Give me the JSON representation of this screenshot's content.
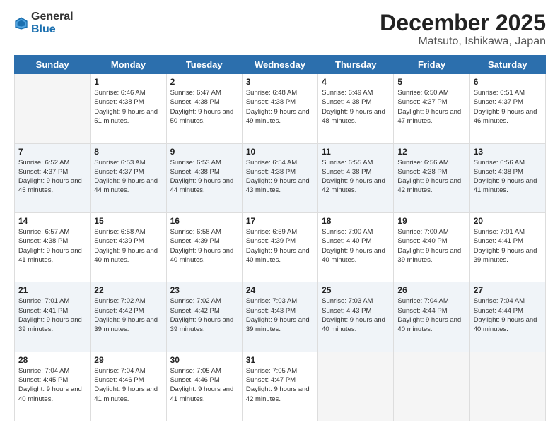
{
  "header": {
    "logo_general": "General",
    "logo_blue": "Blue",
    "month_title": "December 2025",
    "location": "Matsuto, Ishikawa, Japan"
  },
  "days_of_week": [
    "Sunday",
    "Monday",
    "Tuesday",
    "Wednesday",
    "Thursday",
    "Friday",
    "Saturday"
  ],
  "weeks": [
    [
      {
        "day": "",
        "sunrise": "",
        "sunset": "",
        "daylight": ""
      },
      {
        "day": "1",
        "sunrise": "Sunrise: 6:46 AM",
        "sunset": "Sunset: 4:38 PM",
        "daylight": "Daylight: 9 hours and 51 minutes."
      },
      {
        "day": "2",
        "sunrise": "Sunrise: 6:47 AM",
        "sunset": "Sunset: 4:38 PM",
        "daylight": "Daylight: 9 hours and 50 minutes."
      },
      {
        "day": "3",
        "sunrise": "Sunrise: 6:48 AM",
        "sunset": "Sunset: 4:38 PM",
        "daylight": "Daylight: 9 hours and 49 minutes."
      },
      {
        "day": "4",
        "sunrise": "Sunrise: 6:49 AM",
        "sunset": "Sunset: 4:38 PM",
        "daylight": "Daylight: 9 hours and 48 minutes."
      },
      {
        "day": "5",
        "sunrise": "Sunrise: 6:50 AM",
        "sunset": "Sunset: 4:37 PM",
        "daylight": "Daylight: 9 hours and 47 minutes."
      },
      {
        "day": "6",
        "sunrise": "Sunrise: 6:51 AM",
        "sunset": "Sunset: 4:37 PM",
        "daylight": "Daylight: 9 hours and 46 minutes."
      }
    ],
    [
      {
        "day": "7",
        "sunrise": "Sunrise: 6:52 AM",
        "sunset": "Sunset: 4:37 PM",
        "daylight": "Daylight: 9 hours and 45 minutes."
      },
      {
        "day": "8",
        "sunrise": "Sunrise: 6:53 AM",
        "sunset": "Sunset: 4:37 PM",
        "daylight": "Daylight: 9 hours and 44 minutes."
      },
      {
        "day": "9",
        "sunrise": "Sunrise: 6:53 AM",
        "sunset": "Sunset: 4:38 PM",
        "daylight": "Daylight: 9 hours and 44 minutes."
      },
      {
        "day": "10",
        "sunrise": "Sunrise: 6:54 AM",
        "sunset": "Sunset: 4:38 PM",
        "daylight": "Daylight: 9 hours and 43 minutes."
      },
      {
        "day": "11",
        "sunrise": "Sunrise: 6:55 AM",
        "sunset": "Sunset: 4:38 PM",
        "daylight": "Daylight: 9 hours and 42 minutes."
      },
      {
        "day": "12",
        "sunrise": "Sunrise: 6:56 AM",
        "sunset": "Sunset: 4:38 PM",
        "daylight": "Daylight: 9 hours and 42 minutes."
      },
      {
        "day": "13",
        "sunrise": "Sunrise: 6:56 AM",
        "sunset": "Sunset: 4:38 PM",
        "daylight": "Daylight: 9 hours and 41 minutes."
      }
    ],
    [
      {
        "day": "14",
        "sunrise": "Sunrise: 6:57 AM",
        "sunset": "Sunset: 4:38 PM",
        "daylight": "Daylight: 9 hours and 41 minutes."
      },
      {
        "day": "15",
        "sunrise": "Sunrise: 6:58 AM",
        "sunset": "Sunset: 4:39 PM",
        "daylight": "Daylight: 9 hours and 40 minutes."
      },
      {
        "day": "16",
        "sunrise": "Sunrise: 6:58 AM",
        "sunset": "Sunset: 4:39 PM",
        "daylight": "Daylight: 9 hours and 40 minutes."
      },
      {
        "day": "17",
        "sunrise": "Sunrise: 6:59 AM",
        "sunset": "Sunset: 4:39 PM",
        "daylight": "Daylight: 9 hours and 40 minutes."
      },
      {
        "day": "18",
        "sunrise": "Sunrise: 7:00 AM",
        "sunset": "Sunset: 4:40 PM",
        "daylight": "Daylight: 9 hours and 40 minutes."
      },
      {
        "day": "19",
        "sunrise": "Sunrise: 7:00 AM",
        "sunset": "Sunset: 4:40 PM",
        "daylight": "Daylight: 9 hours and 39 minutes."
      },
      {
        "day": "20",
        "sunrise": "Sunrise: 7:01 AM",
        "sunset": "Sunset: 4:41 PM",
        "daylight": "Daylight: 9 hours and 39 minutes."
      }
    ],
    [
      {
        "day": "21",
        "sunrise": "Sunrise: 7:01 AM",
        "sunset": "Sunset: 4:41 PM",
        "daylight": "Daylight: 9 hours and 39 minutes."
      },
      {
        "day": "22",
        "sunrise": "Sunrise: 7:02 AM",
        "sunset": "Sunset: 4:42 PM",
        "daylight": "Daylight: 9 hours and 39 minutes."
      },
      {
        "day": "23",
        "sunrise": "Sunrise: 7:02 AM",
        "sunset": "Sunset: 4:42 PM",
        "daylight": "Daylight: 9 hours and 39 minutes."
      },
      {
        "day": "24",
        "sunrise": "Sunrise: 7:03 AM",
        "sunset": "Sunset: 4:43 PM",
        "daylight": "Daylight: 9 hours and 39 minutes."
      },
      {
        "day": "25",
        "sunrise": "Sunrise: 7:03 AM",
        "sunset": "Sunset: 4:43 PM",
        "daylight": "Daylight: 9 hours and 40 minutes."
      },
      {
        "day": "26",
        "sunrise": "Sunrise: 7:04 AM",
        "sunset": "Sunset: 4:44 PM",
        "daylight": "Daylight: 9 hours and 40 minutes."
      },
      {
        "day": "27",
        "sunrise": "Sunrise: 7:04 AM",
        "sunset": "Sunset: 4:44 PM",
        "daylight": "Daylight: 9 hours and 40 minutes."
      }
    ],
    [
      {
        "day": "28",
        "sunrise": "Sunrise: 7:04 AM",
        "sunset": "Sunset: 4:45 PM",
        "daylight": "Daylight: 9 hours and 40 minutes."
      },
      {
        "day": "29",
        "sunrise": "Sunrise: 7:04 AM",
        "sunset": "Sunset: 4:46 PM",
        "daylight": "Daylight: 9 hours and 41 minutes."
      },
      {
        "day": "30",
        "sunrise": "Sunrise: 7:05 AM",
        "sunset": "Sunset: 4:46 PM",
        "daylight": "Daylight: 9 hours and 41 minutes."
      },
      {
        "day": "31",
        "sunrise": "Sunrise: 7:05 AM",
        "sunset": "Sunset: 4:47 PM",
        "daylight": "Daylight: 9 hours and 42 minutes."
      },
      {
        "day": "",
        "sunrise": "",
        "sunset": "",
        "daylight": ""
      },
      {
        "day": "",
        "sunrise": "",
        "sunset": "",
        "daylight": ""
      },
      {
        "day": "",
        "sunrise": "",
        "sunset": "",
        "daylight": ""
      }
    ]
  ]
}
